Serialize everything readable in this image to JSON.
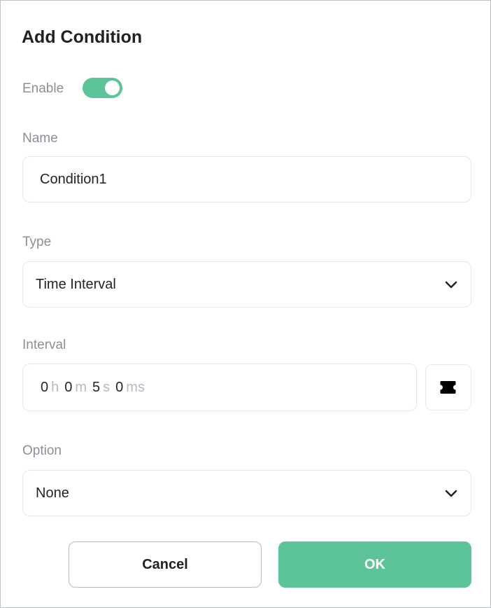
{
  "dialog": {
    "title": "Add Condition"
  },
  "enable": {
    "label": "Enable",
    "on": true,
    "accent_color": "#5cc498"
  },
  "name": {
    "label": "Name",
    "value": "Condition1"
  },
  "type": {
    "label": "Type",
    "selected": "Time Interval",
    "icon": "chevron-down-icon"
  },
  "interval": {
    "label": "Interval",
    "hours": "0",
    "hours_unit": "h",
    "minutes": "0",
    "minutes_unit": "m",
    "seconds": "5",
    "seconds_unit": "s",
    "milliseconds": "0",
    "milliseconds_unit": "ms",
    "variable_icon": "puzzle-icon"
  },
  "option": {
    "label": "Option",
    "selected": "None",
    "icon": "chevron-down-icon"
  },
  "buttons": {
    "cancel": "Cancel",
    "ok": "OK"
  }
}
